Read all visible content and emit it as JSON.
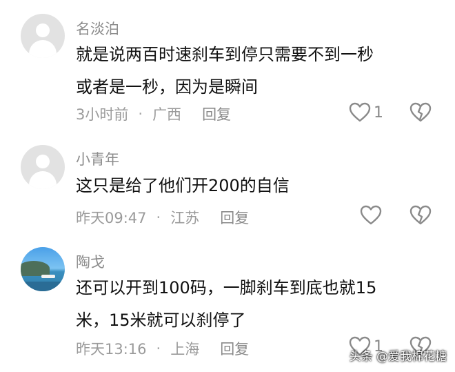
{
  "comments": [
    {
      "username": "名淡泊",
      "text_lines": [
        "就是说两百时速刹车到停只需要不到一秒",
        "或者是一秒，因为是瞬间"
      ],
      "time": "3小时前",
      "location": "广西",
      "reply_label": "回复",
      "like_count": "1"
    },
    {
      "username": "小青年",
      "text_lines": [
        "这只是给了他们开200的自信"
      ],
      "time": "昨天09:47",
      "location": "江苏",
      "reply_label": "回复",
      "like_count": ""
    },
    {
      "username": "陶戈",
      "text_lines": [
        "还可以开到100码，一脚刹车到底也就15",
        "米，15米就可以刹停了"
      ],
      "time": "昨天13:16",
      "location": "上海",
      "reply_label": "回复",
      "like_count": "1"
    }
  ],
  "separator": "·",
  "watermark": "头条 @爱我棉花糖"
}
